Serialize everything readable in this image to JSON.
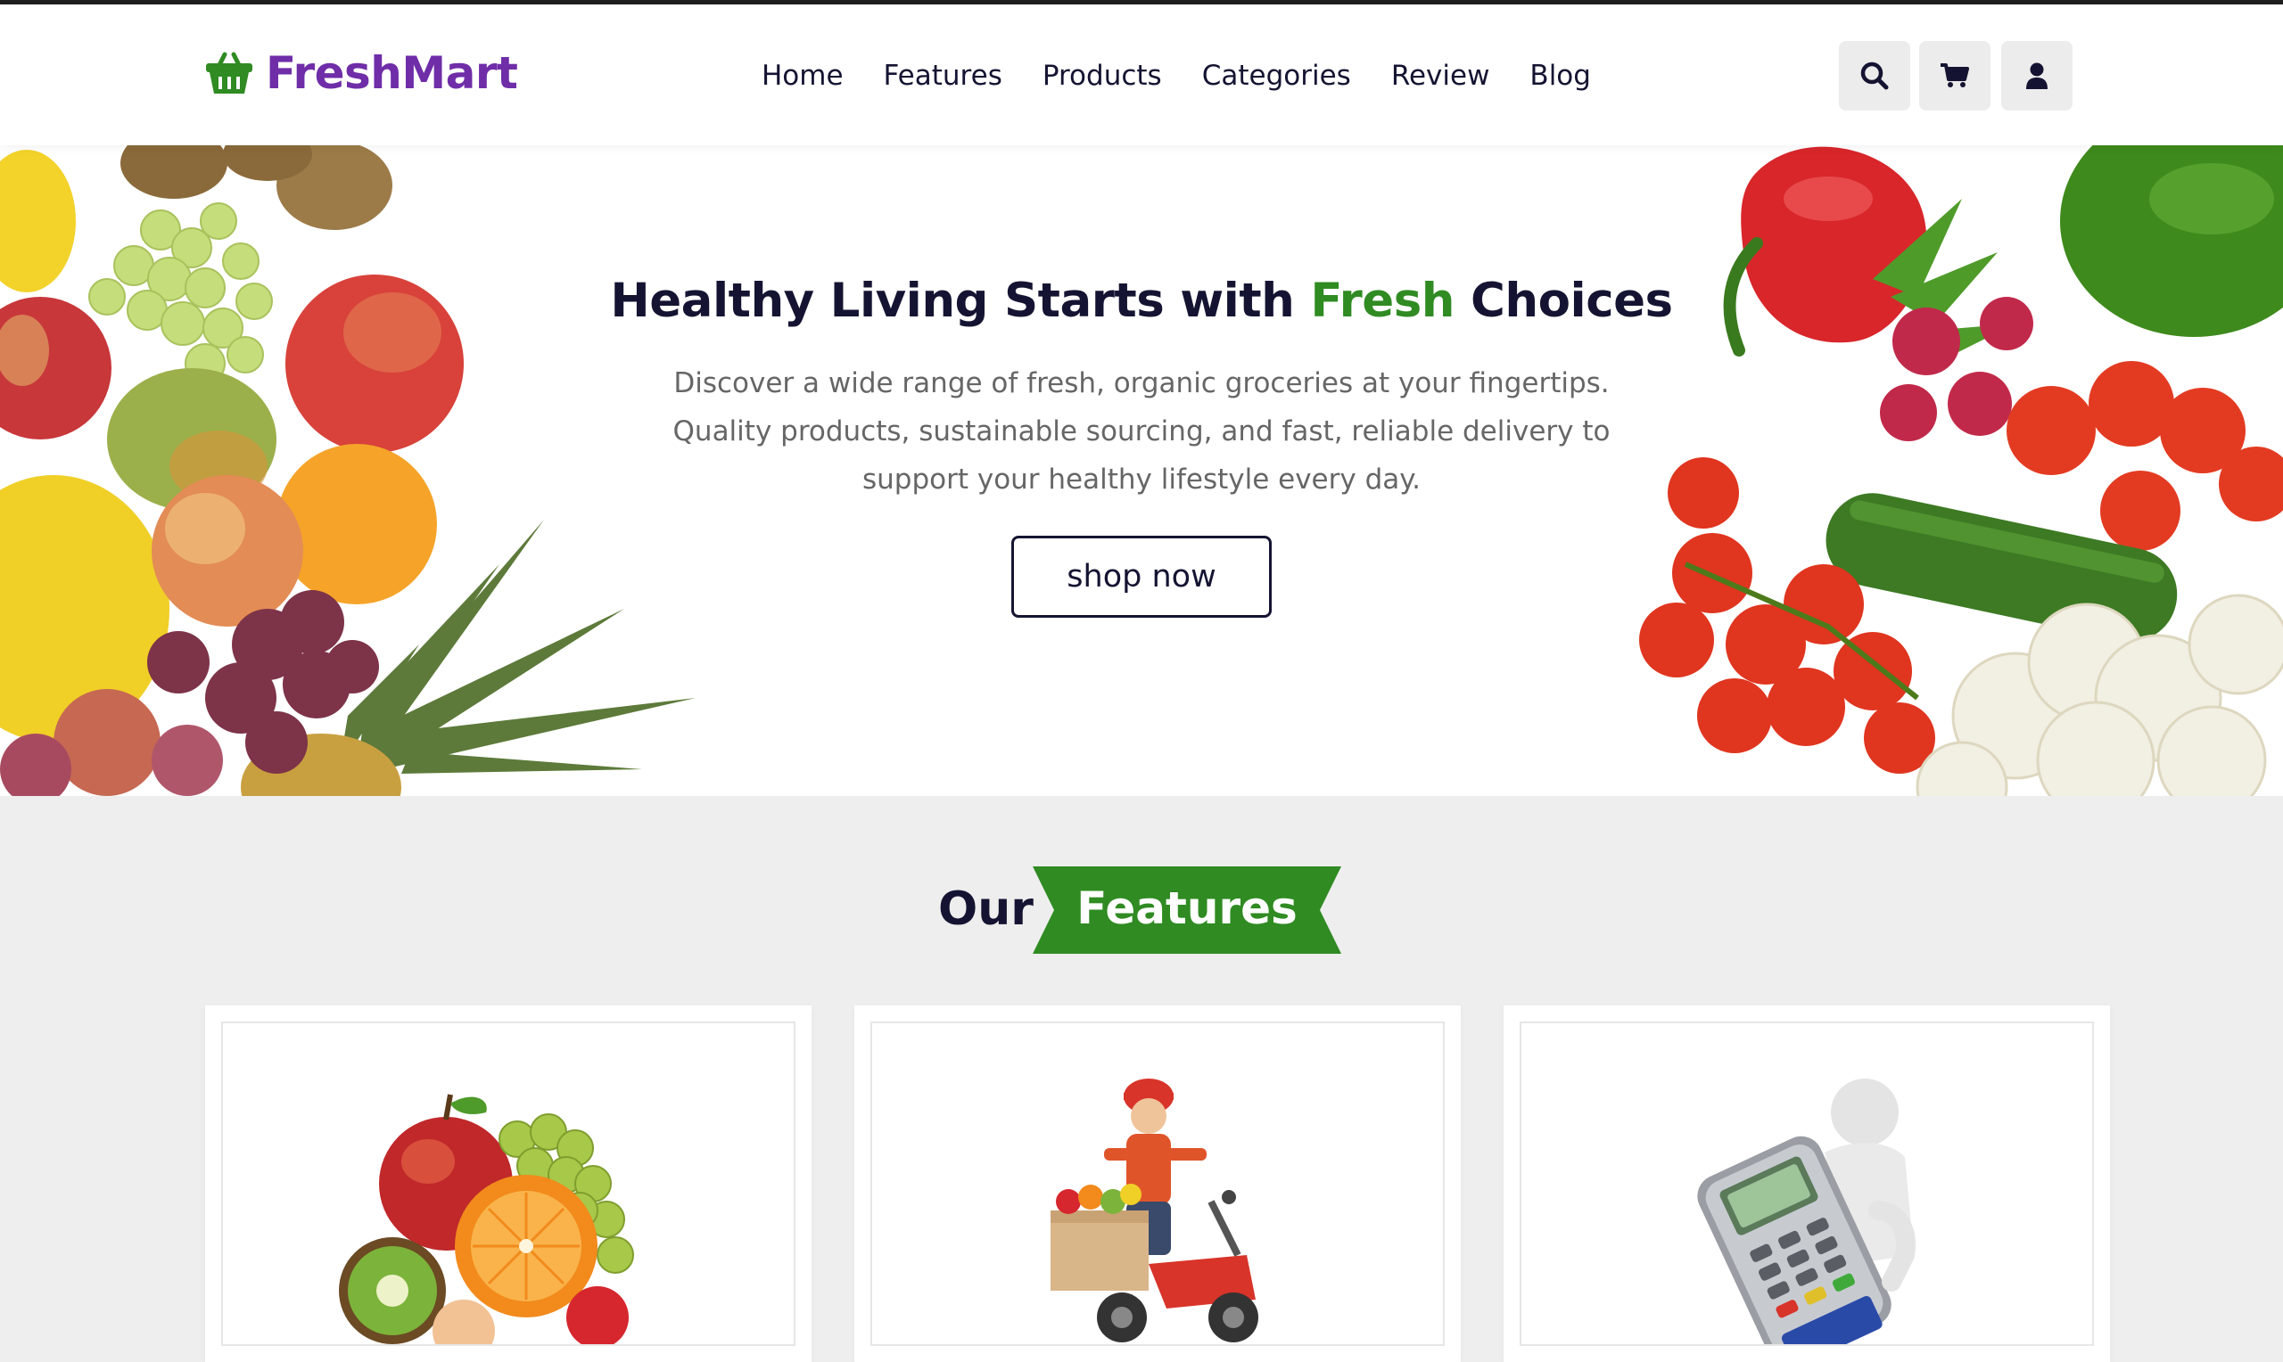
{
  "brand": {
    "name": "FreshMart",
    "color": "#6f2da8",
    "icon": "basket-icon",
    "icon_color": "#2f8b22"
  },
  "nav": {
    "items": [
      "Home",
      "Features",
      "Products",
      "Categories",
      "Review",
      "Blog"
    ]
  },
  "header_icons": [
    "search-icon",
    "cart-icon",
    "user-icon"
  ],
  "hero": {
    "title_part1": "Healthy Living Starts with ",
    "title_highlight": "Fresh",
    "title_part2": " Choices",
    "description": "Discover a wide range of fresh, organic groceries at your fingertips. Quality products, sustainable sourcing, and fast, reliable delivery to support your healthy lifestyle every day.",
    "button_label": "shop now"
  },
  "features": {
    "heading_prefix": "Our",
    "heading_highlight": "Features",
    "ribbon_color": "#2f8b22",
    "cards": [
      {
        "image": "fresh-fruits-image"
      },
      {
        "image": "delivery-scooter-image"
      },
      {
        "image": "card-payment-terminal-image"
      }
    ]
  },
  "colors": {
    "dark_navy": "#141432",
    "accent_green": "#2f8b22",
    "section_bg": "#eeeeee"
  }
}
